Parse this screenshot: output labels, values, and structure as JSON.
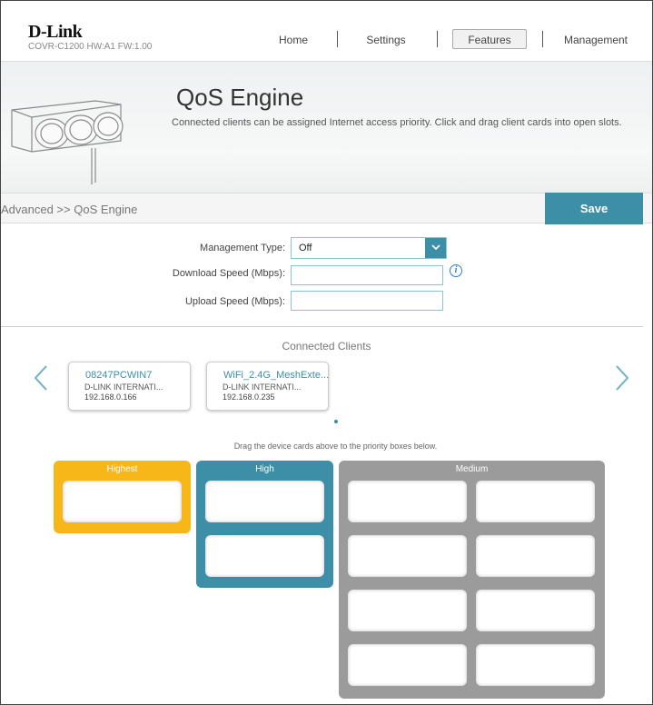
{
  "header": {
    "logo": "D-Link",
    "model": "COVR-C1200 HW:A1 FW:1.00",
    "nav": {
      "home": "Home",
      "settings": "Settings",
      "features": "Features",
      "management": "Management"
    },
    "active_nav": "Features"
  },
  "banner": {
    "title": "QoS Engine",
    "description": "Connected clients can be assigned Internet access priority. Click and drag client cards into open slots."
  },
  "breadcrumb": "Advanced >> QoS Engine",
  "save_label": "Save",
  "form": {
    "management_type_label": "Management Type:",
    "management_type_value": "Off",
    "download_label": "Download Speed (Mbps):",
    "download_value": "",
    "upload_label": "Upload Speed (Mbps):",
    "upload_value": ""
  },
  "clients": {
    "title": "Connected Clients",
    "cards": [
      {
        "name": "08247PCWIN7",
        "vendor": "D-LINK INTERNATI...",
        "ip": "192.168.0.166"
      },
      {
        "name": "WiFi_2.4G_MeshExte...",
        "vendor": "D-LINK INTERNATI...",
        "ip": "192.168.0.235"
      }
    ],
    "drag_hint": "Drag the device cards above to the priority boxes below."
  },
  "priorities": {
    "highest": "Highest",
    "high": "High",
    "medium": "Medium"
  },
  "colors": {
    "accent": "#3d8fa7",
    "highest": "#f7b719",
    "medium": "#9b9b9b"
  },
  "icons": [
    "info-icon",
    "chevron-down-icon",
    "chevron-left-icon",
    "chevron-right-icon"
  ]
}
